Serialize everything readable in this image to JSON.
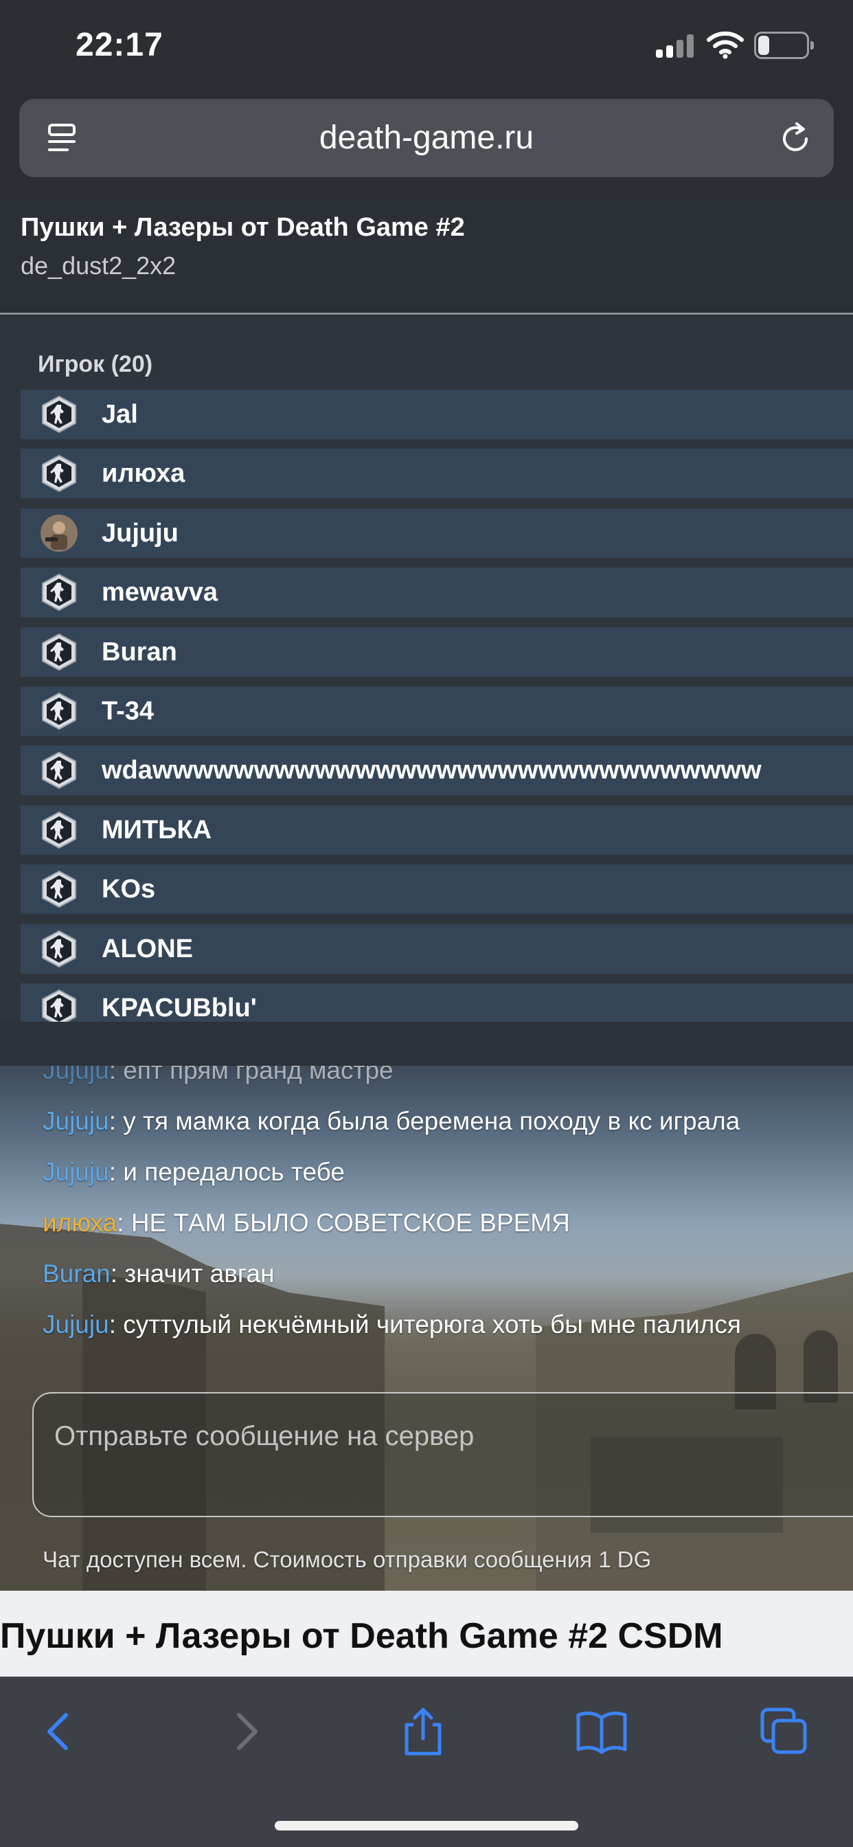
{
  "status_bar": {
    "time": "22:17",
    "battery_percent": "21",
    "battery_level": 0.21
  },
  "browser": {
    "url": "death-game.ru",
    "icons": {
      "tabs": "tab-overview-icon",
      "reload": "reload-icon"
    }
  },
  "server": {
    "title": "Пушки + Лазеры от Death Game #2",
    "map": "de_dust2_2x2"
  },
  "players": {
    "heading": "Игрок (20)",
    "list": [
      {
        "name": "Jal",
        "avatar": "cs-logo"
      },
      {
        "name": "илюха",
        "avatar": "cs-logo"
      },
      {
        "name": "Jujuju",
        "avatar": "photo"
      },
      {
        "name": "mewavva",
        "avatar": "cs-logo"
      },
      {
        "name": "Buran",
        "avatar": "cs-logo"
      },
      {
        "name": "T-34",
        "avatar": "cs-logo"
      },
      {
        "name": "wdawwwwwwwwwwwwwwwwwwwwwwwwwwwwww",
        "avatar": "cs-logo"
      },
      {
        "name": "МИТЬКА",
        "avatar": "cs-logo"
      },
      {
        "name": "KOs",
        "avatar": "cs-logo"
      },
      {
        "name": "ALONE",
        "avatar": "cs-logo"
      },
      {
        "name": "KPACUBblu'",
        "avatar": "cs-logo"
      }
    ]
  },
  "chat": {
    "messages": [
      {
        "author": "Jujuju",
        "text": ": епт прям гранд мастре",
        "author_color": "#5aa8ea"
      },
      {
        "author": "Jujuju",
        "text": ": у тя мамка когда была беремена походу в кс играла",
        "author_color": "#5aa8ea"
      },
      {
        "author": "Jujuju",
        "text": ": и передалось тебе",
        "author_color": "#5aa8ea"
      },
      {
        "author": "илюха",
        "text": ": НЕ ТАМ БЫЛО СОВЕТСКОЕ ВРЕМЯ",
        "author_color": "#f0b12b"
      },
      {
        "author": "Buran",
        "text": ": значит авган",
        "author_color": "#5aa8ea"
      },
      {
        "author": "Jujuju",
        "text": ": суттулый некчёмный читерюга хоть бы мне палился",
        "author_color": "#5aa8ea"
      }
    ],
    "input_placeholder": "Отправьте сообщение на сервер",
    "note": "Чат доступен всем. Стоимость отправки сообщения 1 DG"
  },
  "page_heading": "Пушки + Лазеры от Death Game #2 CSDM",
  "toolbar": {
    "buttons": [
      "back-icon",
      "forward-icon",
      "share-icon",
      "bookmarks-icon",
      "tabs-icon"
    ]
  },
  "colors": {
    "accent": "#3b82f6",
    "player_row": "#344557",
    "author_blue": "#5aa8ea",
    "author_gold": "#f0b12b"
  }
}
